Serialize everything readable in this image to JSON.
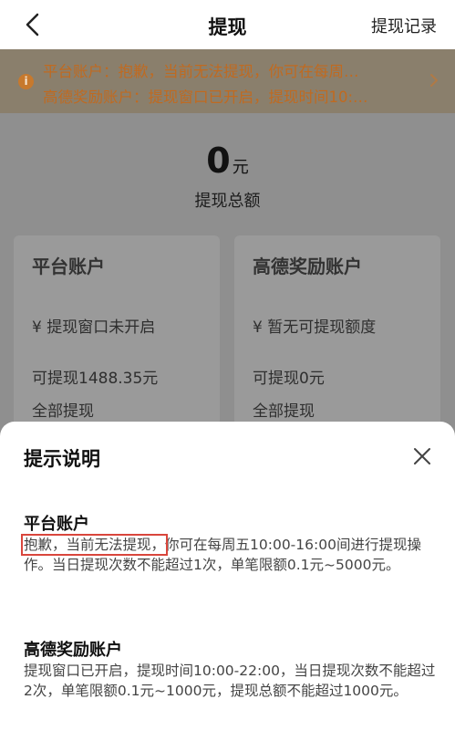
{
  "nav": {
    "title": "提现",
    "record_label": "提现记录"
  },
  "notice": {
    "icon_text": "i",
    "line1": "平台账户：抱歉，当前无法提现，你可在每周…",
    "line2": "高德奖励账户：提现窗口已开启，提现时间10:…"
  },
  "summary": {
    "amount": "0",
    "unit": "元",
    "label": "提现总额"
  },
  "cards": {
    "platform": {
      "title": "平台账户",
      "status": "¥ 提现窗口未开启",
      "available": "可提现1488.35元",
      "all_label": "全部提现"
    },
    "reward": {
      "title": "高德奖励账户",
      "status": "¥ 暂无可提现额度",
      "available": "可提现0元",
      "all_label": "全部提现"
    }
  },
  "sheet": {
    "title": "提示说明",
    "platform": {
      "title": "平台账户",
      "highlight": "抱歉，当前无法提现，",
      "text": "你可在每周五10:00-16:00间进行提现操作。当日提现次数不能超过1次，单笔限额0.1元~5000元。"
    },
    "reward": {
      "title": "高德奖励账户",
      "text": "提现窗口已开启，提现时间10:00-22:00，当日提现次数不能超过2次，单笔限额0.1元~1000元，提现总额不能超过1000元。"
    }
  },
  "colors": {
    "notice_text": "#c06a20",
    "highlight_border": "#d9463c"
  }
}
